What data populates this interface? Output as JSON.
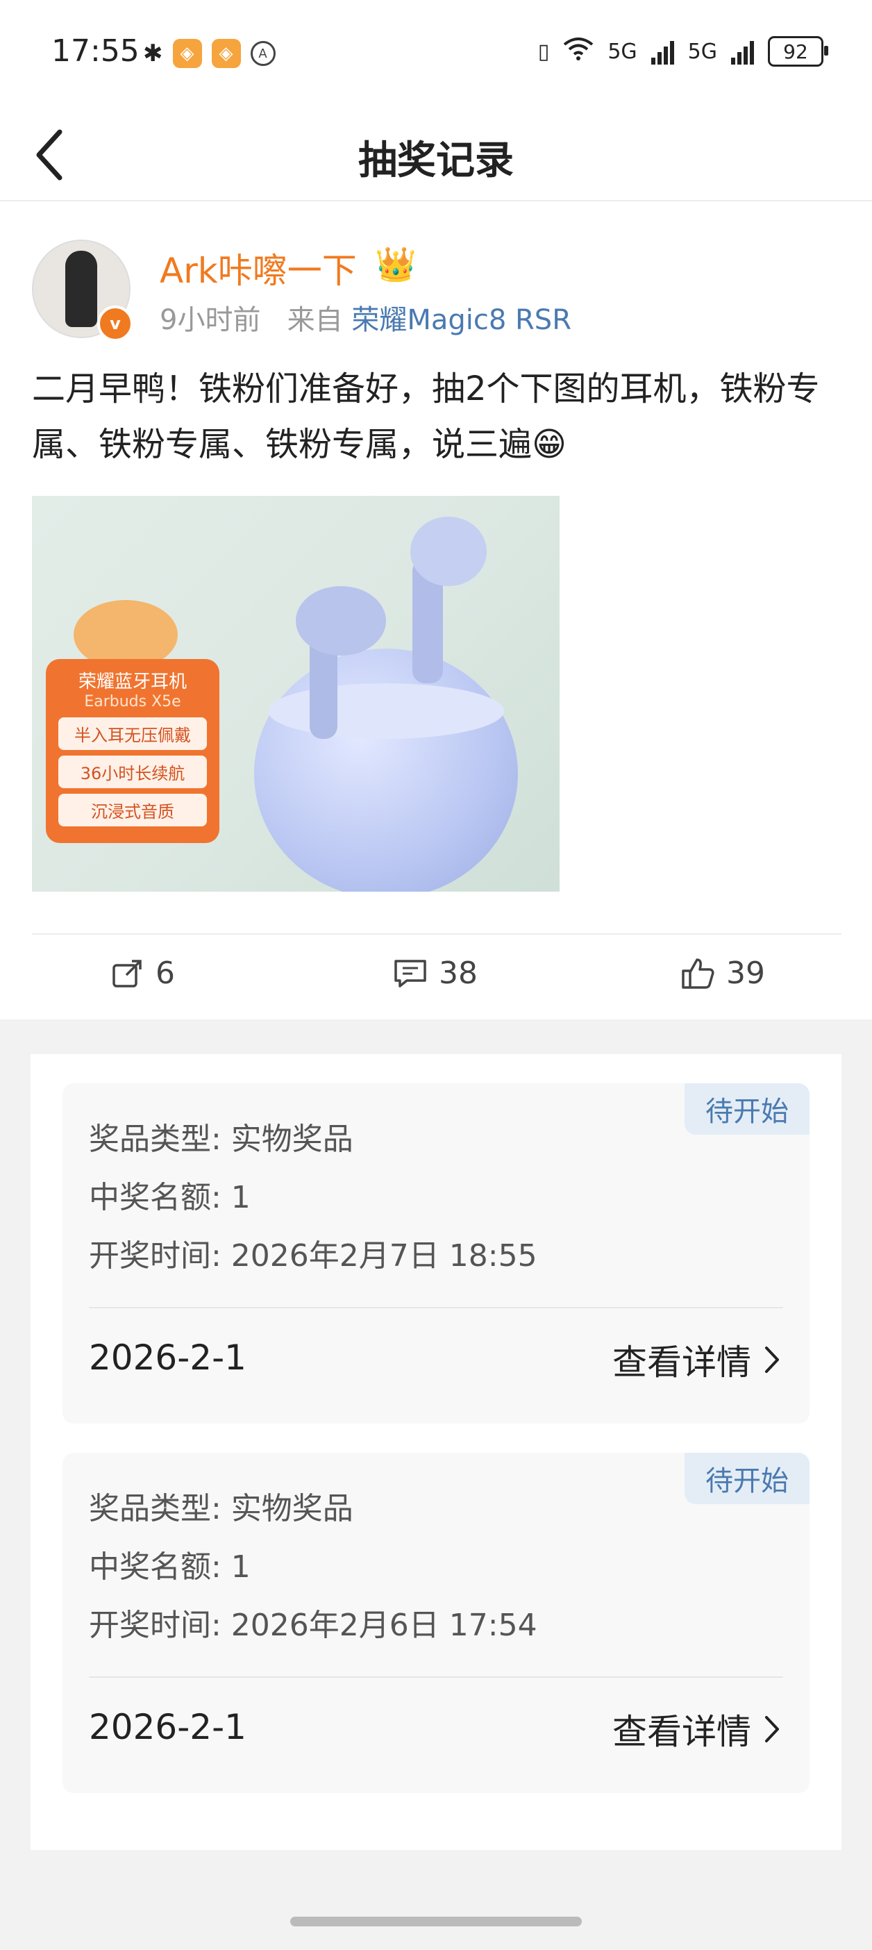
{
  "status_bar": {
    "time": "17:55",
    "net_label_1": "5G",
    "net_label_2": "5G",
    "battery": "92"
  },
  "nav": {
    "title": "抽奖记录"
  },
  "post": {
    "username": "Ark咔嚓一下",
    "time_ago": "9小时前",
    "source_prefix": "来自",
    "device": "荣耀Magic8 RSR",
    "text": "二月早鸭！铁粉们准备好，抽2个下图的耳机，铁粉专属、铁粉专属、铁粉专属，说三遍😁",
    "image_promo": {
      "title": "荣耀蓝牙耳机",
      "model": "Earbuds X5e",
      "tags": [
        "半入耳无压佩戴",
        "36小时长续航",
        "沉浸式音质"
      ]
    },
    "repost_count": "6",
    "comment_count": "38",
    "like_count": "39"
  },
  "records": [
    {
      "status": "待开始",
      "prize_type": "奖品类型: 实物奖品",
      "winners": "中奖名额: 1",
      "draw_time": "开奖时间: 2026年2月7日 18:55",
      "date": "2026-2-1",
      "detail_label": "查看详情"
    },
    {
      "status": "待开始",
      "prize_type": "奖品类型: 实物奖品",
      "winners": "中奖名额: 1",
      "draw_time": "开奖时间: 2026年2月6日 17:54",
      "date": "2026-2-1",
      "detail_label": "查看详情"
    }
  ]
}
